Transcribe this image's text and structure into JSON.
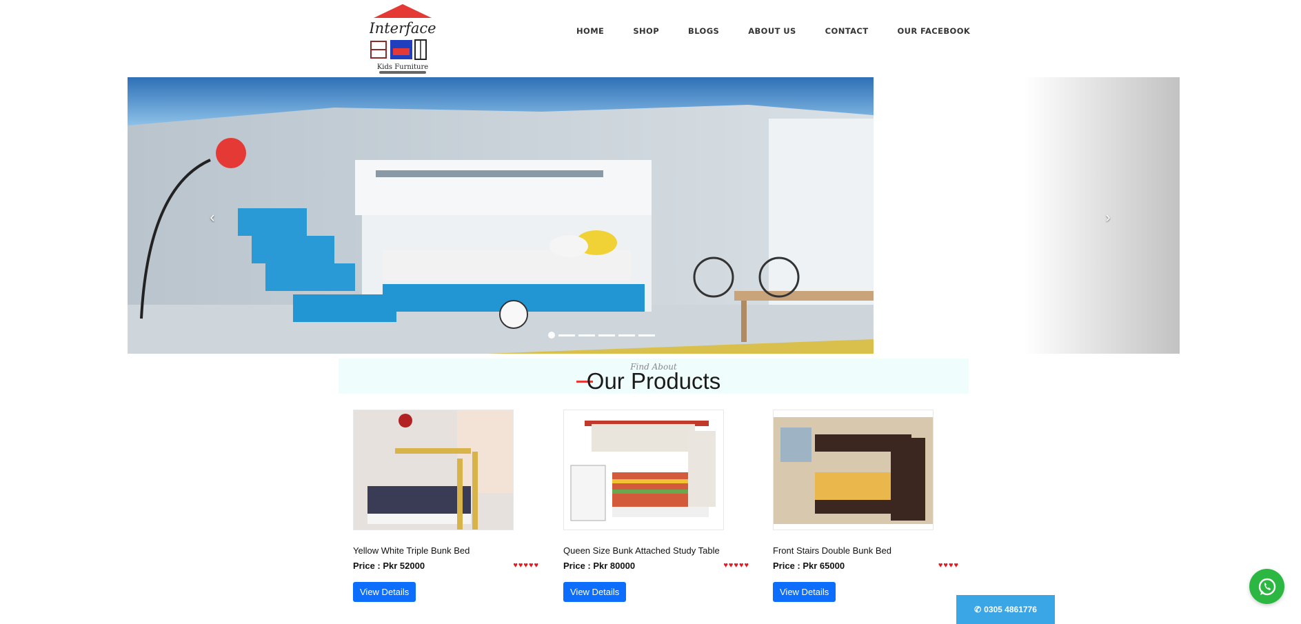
{
  "brand": {
    "logo_title": "Interface",
    "logo_subtitle": "Kids Furniture",
    "roof_color": "#e53935"
  },
  "nav": {
    "items": [
      {
        "label": "HOME"
      },
      {
        "label": "SHOP"
      },
      {
        "label": "BLOGS"
      },
      {
        "label": "ABOUT US"
      },
      {
        "label": "CONTACT"
      },
      {
        "label": "OUR FACEBOOK"
      }
    ]
  },
  "slider": {
    "prev_icon": "chevron-left-icon",
    "next_icon": "chevron-right-icon",
    "prev_glyph": "‹",
    "next_glyph": "›",
    "slide_count": 6,
    "active_index": 0
  },
  "section": {
    "kicker": "Find About",
    "title": "Our Products",
    "accent_color": "#e53935"
  },
  "products": [
    {
      "name": "Yellow White Triple Bunk Bed",
      "price": "Price : Pkr 52000",
      "stars": "♥♥♥♥♥",
      "button": "View Details"
    },
    {
      "name": "Queen Size Bunk Attached Study Table",
      "price": "Price : Pkr 80000",
      "stars": "♥♥♥♥♥",
      "button": "View Details"
    },
    {
      "name": "Front Stairs Double Bunk Bed",
      "price": "Price : Pkr 65000",
      "stars": "♥♥♥♥",
      "button": "View Details"
    }
  ],
  "contact": {
    "phone": "0305 4861776",
    "phone_icon": "phone-icon",
    "whatsapp_icon": "whatsapp-icon"
  },
  "colors": {
    "button_blue": "#0d6efd",
    "phone_blue": "#3aa6e6",
    "whatsapp_green": "#2cb742",
    "star_red": "#e01b24"
  }
}
